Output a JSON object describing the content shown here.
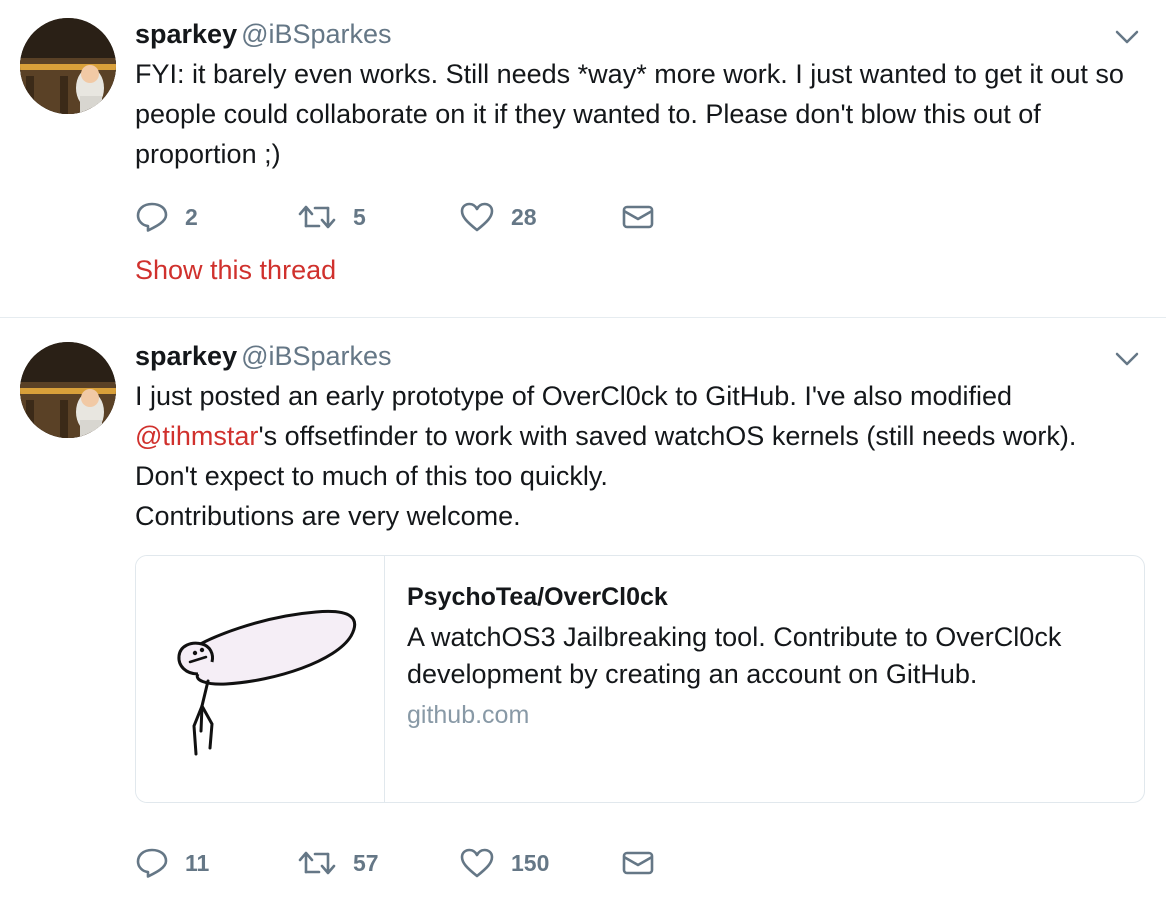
{
  "tweets": [
    {
      "name": "sparkey",
      "handle": "@iBSparkes",
      "text": "FYI: it barely even works. Still needs *way* more work. I just wanted to get it out so people could collaborate on it if they wanted to. Please don't blow this out of proportion ;)",
      "replies": "2",
      "retweets": "5",
      "likes": "28",
      "show_thread": "Show this thread"
    },
    {
      "name": "sparkey",
      "handle": "@iBSparkes",
      "text_line1": "I just posted an early prototype of OverCl0ck to GitHub. I've also modified",
      "mention": "@tihmstar",
      "text_line2_rest": "'s offsetfinder to work with saved watchOS kernels (still needs work).",
      "text_line3": "Don't expect to much of this too quickly.",
      "text_line4": "Contributions are very welcome.",
      "card": {
        "title": "PsychoTea/OverCl0ck",
        "description": "A watchOS3 Jailbreaking tool. Contribute to OverCl0ck development by creating an account on GitHub.",
        "domain": "github.com"
      },
      "replies": "11",
      "retweets": "57",
      "likes": "150"
    }
  ],
  "icons": {
    "reply": "reply-icon",
    "retweet": "retweet-icon",
    "like": "heart-icon",
    "message": "envelope-icon",
    "caret": "chevron-down-icon"
  },
  "colors": {
    "link": "#d0312d",
    "secondary_text": "#657786",
    "icon": "#657786"
  }
}
